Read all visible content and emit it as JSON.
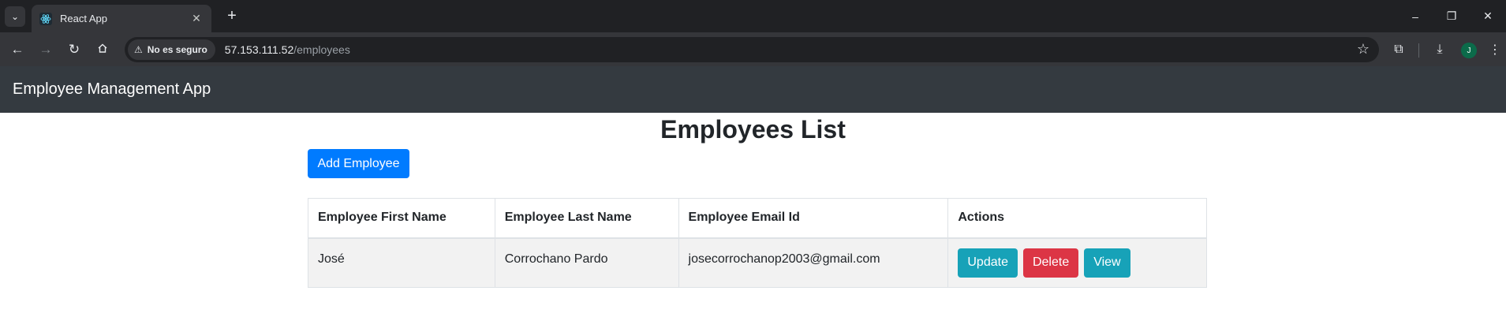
{
  "browser": {
    "tab_title": "React App",
    "security_label": "No es seguro",
    "url_host": "57.153.111.52",
    "url_path": "/employees",
    "profile_initial": "J",
    "icons": {
      "tab_search": "chevron-down-icon",
      "favicon": "react-icon",
      "close": "close-icon",
      "new_tab": "plus-icon",
      "back": "arrow-left-icon",
      "forward": "arrow-right-icon",
      "reload": "reload-icon",
      "home": "home-icon",
      "warning": "warning-icon",
      "bookmark": "star-icon",
      "extensions": "puzzle-icon",
      "downloads": "download-icon",
      "menu": "kebab-menu-icon"
    }
  },
  "app": {
    "brand": "Employee Management App",
    "heading": "Employees List",
    "add_button": "Add Employee",
    "table": {
      "headers": [
        "Employee First Name",
        "Employee Last Name",
        "Employee Email Id",
        "Actions"
      ],
      "rows": [
        {
          "first_name": "José",
          "last_name": "Corrochano Pardo",
          "email": "josecorrochanop2003@gmail.com",
          "actions": [
            "Update",
            "Delete",
            "View"
          ]
        }
      ]
    },
    "colors": {
      "navbar": "#343a40",
      "primary": "#007bff",
      "info": "#17a2b8",
      "danger": "#dc3545"
    }
  }
}
